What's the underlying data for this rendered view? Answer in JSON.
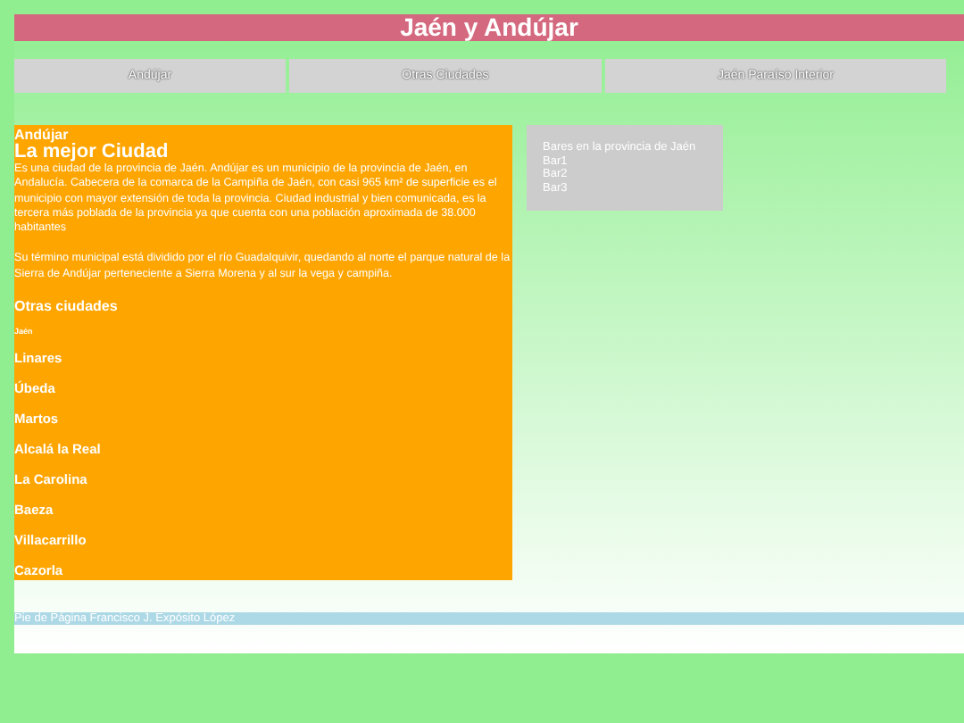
{
  "header": {
    "title": "Jaén y Andújar"
  },
  "nav": [
    "Andújar",
    "Otras Ciudades",
    "Jaén Paraíso Interior"
  ],
  "article": {
    "kicker": "Andújar",
    "heading": "La mejor Ciudad",
    "paragraphs": [
      "Es una ciudad de la provincia de Jaén. Andújar es un municipio de la provincia de Jaén, en Andalucía. Cabecera de la comarca de la Campiña de Jaén, con casi 965 km² de superficie es el municipio con mayor extensión de toda la provincia. Ciudad industrial y bien comunicada, es la tercera más poblada de la provincia ya que cuenta con una población aproximada de 38.000 habitantes",
      "Su término municipal está dividido por el río Guadalquivir, quedando al norte el parque natural de la Sierra de Andújar perteneciente a Sierra Morena y al sur la vega y campiña."
    ],
    "section_title": "Otras ciudades",
    "small_label": "Jaén",
    "cities": [
      "Linares",
      "Úbeda",
      "Martos",
      "Alcalá la Real",
      "La Carolina",
      "Baeza",
      "Villacarrillo",
      "Cazorla"
    ]
  },
  "aside": [
    "Bares en la provincia de Jaén",
    "Bar1",
    "Bar2",
    "Bar3"
  ],
  "footer": "Pie de Página Francisco J. Expósito López"
}
